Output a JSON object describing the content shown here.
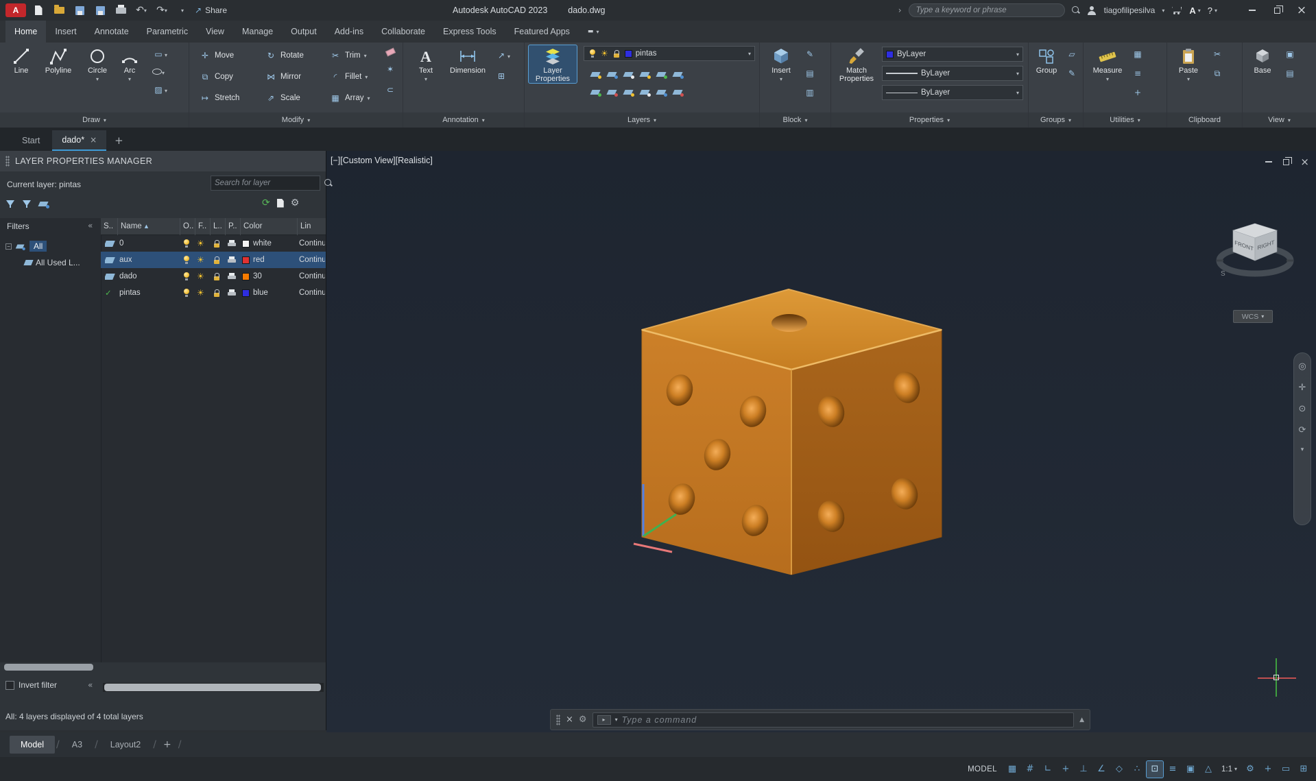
{
  "icons": {
    "search-icon": "magnifier css circle+handle",
    "settings-gear-icon": "⚙",
    "refresh-icon": "⟳",
    "undo-icon": "↶",
    "redo-icon": "↷",
    "share-icon": "↗",
    "sun-icon": "☀",
    "current-layer-check-icon": "✓",
    "dropdown-arrow-icon": "▾",
    "collapse-chevrons-icon": "«",
    "close-icon": "×",
    "text_tool_letter": "A"
  },
  "titlebar": {
    "logo_letter": "A",
    "app_title": "Autodesk AutoCAD 2023",
    "doc_title": "dado.dwg",
    "share_label": "Share",
    "search_placeholder": "Type a keyword or phrase",
    "username": "tiagofilipesilva",
    "help_label": "?"
  },
  "ribbon_tabs": {
    "home": "Home",
    "insert": "Insert",
    "annotate": "Annotate",
    "parametric": "Parametric",
    "view": "View",
    "manage": "Manage",
    "output": "Output",
    "addins": "Add-ins",
    "collaborate": "Collaborate",
    "express": "Express Tools",
    "featured": "Featured Apps"
  },
  "ribbon": {
    "draw": {
      "label": "Draw",
      "line": "Line",
      "polyline": "Polyline",
      "circle": "Circle",
      "arc": "Arc"
    },
    "modify": {
      "label": "Modify",
      "move": "Move",
      "rotate": "Rotate",
      "trim": "Trim",
      "copy": "Copy",
      "mirror": "Mirror",
      "fillet": "Fillet",
      "stretch": "Stretch",
      "scale": "Scale",
      "array": "Array"
    },
    "annotation": {
      "label": "Annotation",
      "text": "Text",
      "dimension": "Dimension"
    },
    "layers": {
      "label": "Layers",
      "layer_properties": "Layer Properties",
      "current_layer": "pintas"
    },
    "block": {
      "label": "Block",
      "insert": "Insert"
    },
    "properties": {
      "label": "Properties",
      "match_properties": "Match Properties",
      "color_value": "ByLayer",
      "lineweight_value": "ByLayer",
      "linetype_value": "ByLayer"
    },
    "groups": {
      "label": "Groups",
      "group": "Group"
    },
    "utilities": {
      "label": "Utilities",
      "measure": "Measure"
    },
    "clipboard": {
      "label": "Clipboard",
      "paste": "Paste"
    },
    "view": {
      "label": "View",
      "base": "Base"
    }
  },
  "file_tabs": {
    "start": "Start",
    "active": "dado*"
  },
  "layer_palette": {
    "title": "LAYER PROPERTIES MANAGER",
    "current_layer_text": "Current layer: pintas",
    "search_placeholder": "Search for layer",
    "filters_label": "Filters",
    "tree": {
      "all": "All",
      "all_used": "All Used L..."
    },
    "columns": {
      "status": "S..",
      "name": "Name",
      "on": "O..",
      "freeze": "F..",
      "lock": "L..",
      "plot": "P..",
      "color": "Color",
      "linetype": "Lin"
    },
    "rows": [
      {
        "name": "0",
        "color_name": "white",
        "color_hex": "#f2f2f2",
        "linetype": "Continuous"
      },
      {
        "name": "aux",
        "color_name": "red",
        "color_hex": "#e03232",
        "linetype": "Continuous"
      },
      {
        "name": "dado",
        "color_name": "30",
        "color_hex": "#f57b00",
        "linetype": "Continuous"
      },
      {
        "name": "pintas",
        "color_name": "blue",
        "color_hex": "#2e2ee0",
        "linetype": "Continuous"
      }
    ],
    "invert_filter_label": "Invert filter",
    "status_text": "All: 4 layers displayed of 4 total layers"
  },
  "viewport": {
    "control_minus": "[−]",
    "control_view": "[Custom View]",
    "control_style": "[Realistic]",
    "viewcube": {
      "front": "FRONT",
      "right": "RIGHT",
      "south": "S"
    },
    "wcs_label": "WCS",
    "command_placeholder": "Type a command"
  },
  "layout_tabs": {
    "model": "Model",
    "a3": "A3",
    "layout2": "Layout2"
  },
  "status_bar": {
    "model_label": "MODEL",
    "annotation_scale": "1:1"
  },
  "colors": {
    "accent_blue": "#3e9bd6",
    "selected_row": "#2d5079",
    "canvas_bg": "#212a35",
    "ribbon_bg": "#3b4046",
    "chrome_bg": "#2b2f33",
    "property_color_swatch": "#2e2ee0",
    "die_top": "#d08a2e",
    "die_left": "#c07424",
    "die_right": "#a05f16",
    "die_pip_dark": "#5f3306"
  }
}
